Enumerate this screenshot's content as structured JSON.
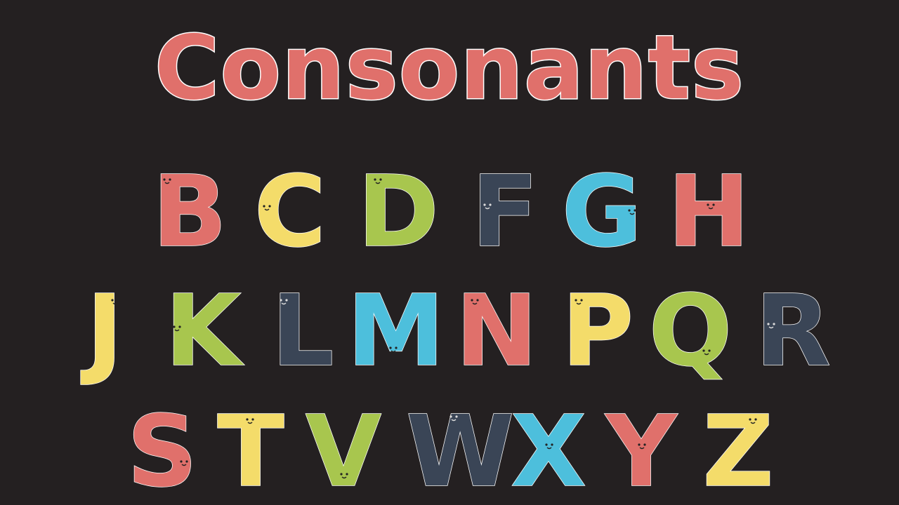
{
  "title": "Consonants",
  "colors": {
    "background": "#242021",
    "red": "#e0706b",
    "yellow": "#f4dc6a",
    "green": "#a8c64e",
    "navy": "#3a4556",
    "cyan": "#4dbfdc",
    "outline": "#ffffff"
  },
  "rows": [
    [
      {
        "char": "B",
        "color": "red"
      },
      {
        "char": "C",
        "color": "yellow"
      },
      {
        "char": "D",
        "color": "green"
      },
      {
        "char": "F",
        "color": "navy"
      },
      {
        "char": "G",
        "color": "cyan"
      },
      {
        "char": "H",
        "color": "red"
      }
    ],
    [
      {
        "char": "J",
        "color": "yellow"
      },
      {
        "char": "K",
        "color": "green"
      },
      {
        "char": "L",
        "color": "navy"
      },
      {
        "char": "M",
        "color": "cyan"
      },
      {
        "char": "N",
        "color": "red"
      },
      {
        "char": "P",
        "color": "yellow"
      },
      {
        "char": "Q",
        "color": "green"
      },
      {
        "char": "R",
        "color": "navy"
      }
    ],
    [
      {
        "char": "S",
        "color": "red"
      },
      {
        "char": "T",
        "color": "yellow"
      },
      {
        "char": "V",
        "color": "green"
      },
      {
        "char": "W",
        "color": "navy"
      },
      {
        "char": "X",
        "color": "cyan"
      },
      {
        "char": "Y",
        "color": "red"
      },
      {
        "char": "Z",
        "color": "yellow"
      }
    ]
  ]
}
